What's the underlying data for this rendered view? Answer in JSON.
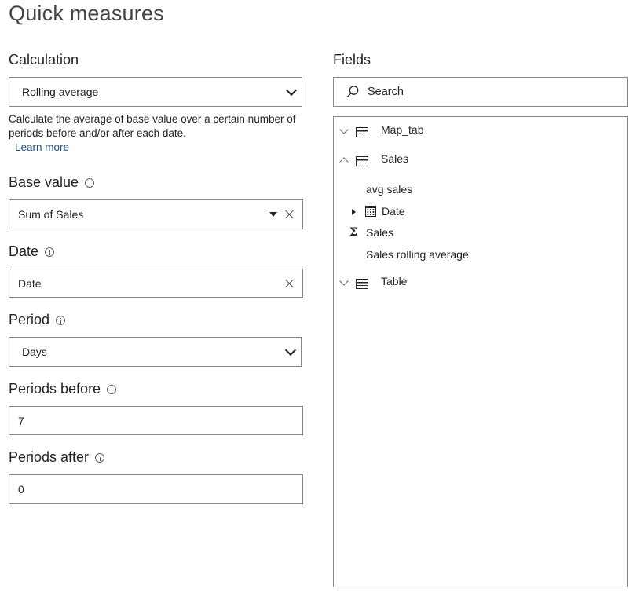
{
  "title": "Quick measures",
  "calculation": {
    "label": "Calculation",
    "selected": "Rolling average",
    "description": "Calculate the average of base value over a certain number of periods before and/or after each date.",
    "learn_more": "Learn more"
  },
  "base_value": {
    "label": "Base value",
    "value": "Sum of Sales"
  },
  "date": {
    "label": "Date",
    "value": "Date"
  },
  "period": {
    "label": "Period",
    "selected": "Days"
  },
  "periods_before": {
    "label": "Periods before",
    "value": "7"
  },
  "periods_after": {
    "label": "Periods after",
    "value": "0"
  },
  "fields": {
    "label": "Fields",
    "search_placeholder": "Search",
    "tables": [
      {
        "name": "Map_tab",
        "expanded": false,
        "icon": "table-icon"
      },
      {
        "name": "Sales",
        "expanded": true,
        "icon": "table-icon",
        "items": [
          {
            "name": "avg sales",
            "icon": "calculator-icon"
          },
          {
            "name": "Date",
            "icon": "calendar-icon",
            "expandable": true
          },
          {
            "name": "Sales",
            "icon": "sigma-icon"
          },
          {
            "name": "Sales rolling average",
            "icon": "calculator-icon"
          }
        ]
      },
      {
        "name": "Table",
        "expanded": false,
        "icon": "table-icon"
      }
    ]
  },
  "colors": {
    "border": "#8a8886",
    "text": "#252423",
    "link": "#1a4d8f"
  }
}
